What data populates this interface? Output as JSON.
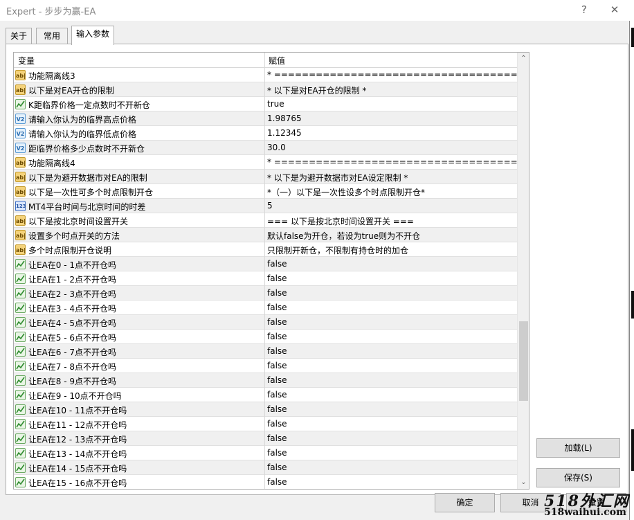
{
  "window": {
    "title": "Expert - 步步为赢-EA",
    "help_icon": "?",
    "close_icon": "✕"
  },
  "tabs": [
    {
      "label": "关于"
    },
    {
      "label": "常用"
    },
    {
      "label": "输入参数"
    }
  ],
  "grid": {
    "col_name": "变量",
    "col_value": "赋值",
    "rows": [
      {
        "icon": "string",
        "name": "功能隔离线3",
        "value": "* ==================================== *"
      },
      {
        "icon": "string",
        "name": "以下是对EA开仓的限制",
        "value": "* 以下是对EA开仓的限制 *"
      },
      {
        "icon": "bool",
        "name": "K距临界价格一定点数时不开新仓",
        "value": "true"
      },
      {
        "icon": "double",
        "name": "请输入你认为的临界高点价格",
        "value": "1.98765"
      },
      {
        "icon": "double",
        "name": "请输入你认为的临界低点价格",
        "value": "1.12345"
      },
      {
        "icon": "double",
        "name": "距临界价格多少点数时不开新仓",
        "value": "30.0"
      },
      {
        "icon": "string",
        "name": "功能隔离线4",
        "value": "* ==================================== *"
      },
      {
        "icon": "string",
        "name": "以下是为避开数据市对EA的限制",
        "value": "* 以下是为避开数据市对EA设定限制 *"
      },
      {
        "icon": "string",
        "name": "以下是一次性可多个时点限制开仓",
        "value": "*（一）以下是一次性设多个时点限制开仓*"
      },
      {
        "icon": "int",
        "name": "MT4平台时间与北京时间的时差",
        "value": "5"
      },
      {
        "icon": "string",
        "name": "以下是按北京时间设置开关",
        "value": "=== 以下是按北京时间设置开关 ==="
      },
      {
        "icon": "string",
        "name": "设置多个时点开关的方法",
        "value": "默认false为开仓，若设为true则为不开仓"
      },
      {
        "icon": "string",
        "name": "多个时点限制开仓说明",
        "value": "只限制开新仓，不限制有持仓时的加仓"
      },
      {
        "icon": "bool",
        "name": "让EA在0 - 1点不开仓吗",
        "value": "false"
      },
      {
        "icon": "bool",
        "name": "让EA在1 - 2点不开仓吗",
        "value": "false"
      },
      {
        "icon": "bool",
        "name": "让EA在2 - 3点不开仓吗",
        "value": "false"
      },
      {
        "icon": "bool",
        "name": "让EA在3 - 4点不开仓吗",
        "value": "false"
      },
      {
        "icon": "bool",
        "name": "让EA在4 - 5点不开仓吗",
        "value": "false"
      },
      {
        "icon": "bool",
        "name": "让EA在5 - 6点不开仓吗",
        "value": "false"
      },
      {
        "icon": "bool",
        "name": "让EA在6 - 7点不开仓吗",
        "value": "false"
      },
      {
        "icon": "bool",
        "name": "让EA在7 - 8点不开仓吗",
        "value": "false"
      },
      {
        "icon": "bool",
        "name": "让EA在8 - 9点不开仓吗",
        "value": "false"
      },
      {
        "icon": "bool",
        "name": "让EA在9 - 10点不开仓吗",
        "value": "false"
      },
      {
        "icon": "bool",
        "name": "让EA在10 - 11点不开仓吗",
        "value": "false"
      },
      {
        "icon": "bool",
        "name": "让EA在11 - 12点不开仓吗",
        "value": "false"
      },
      {
        "icon": "bool",
        "name": "让EA在12 - 13点不开仓吗",
        "value": "false"
      },
      {
        "icon": "bool",
        "name": "让EA在13 - 14点不开仓吗",
        "value": "false"
      },
      {
        "icon": "bool",
        "name": "让EA在14 - 15点不开仓吗",
        "value": "false"
      },
      {
        "icon": "bool",
        "name": "让EA在15 - 16点不开仓吗",
        "value": "false"
      }
    ]
  },
  "icon_glyphs": {
    "string": "ab|",
    "double": "V2",
    "int": "123"
  },
  "buttons": {
    "load": "加载(L)",
    "save": "保存(S)",
    "ok": "确定",
    "cancel": "取消",
    "reset": "重置"
  },
  "watermark": {
    "line1": "518外汇网",
    "line2": "518waihui.com"
  }
}
